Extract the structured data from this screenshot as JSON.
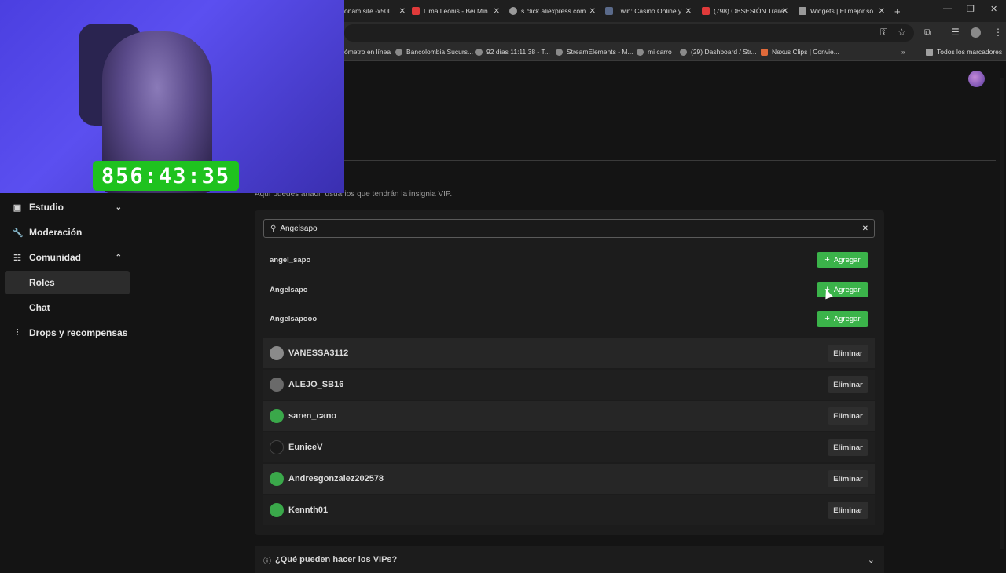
{
  "browser": {
    "tabs": [
      {
        "title": "onam.site -x50l",
        "color": "#6a6a6a"
      },
      {
        "title": "Lima Leonis - Bei Min",
        "color": "#e03a3a"
      },
      {
        "title": "s.click.aliexpress.com",
        "color": "#9a9a9a"
      },
      {
        "title": "Twin: Casino Online y",
        "color": "#5a6a8a"
      },
      {
        "title": "(798) OBSESIÓN Tráile",
        "color": "#e03a3a"
      },
      {
        "title": "Widgets | El mejor so",
        "color": "#9a9a9a"
      }
    ],
    "new_tab": "+",
    "bookmarks": [
      "ómetro en línea",
      "Bancolombia Sucurs...",
      "92 días 11:11:38 - T...",
      "StreamElements - M...",
      "mi carro",
      "(29) Dashboard / Str...",
      "Nexus Clips | Convie..."
    ],
    "all_bookmarks": "Todos los marcadores"
  },
  "overlay": {
    "timer": "856:43:35"
  },
  "sidebar": {
    "items": [
      {
        "label": "Estudio",
        "icon": "studio-icon",
        "chevron": "down"
      },
      {
        "label": "Moderación",
        "icon": "wrench-icon"
      },
      {
        "label": "Comunidad",
        "icon": "community-icon",
        "chevron": "up"
      },
      {
        "label": "Roles",
        "active": true
      },
      {
        "label": "Chat"
      },
      {
        "label": "Drops y recompensas",
        "icon": "drops-icon"
      }
    ]
  },
  "main": {
    "subtitle": "Aquí puedes añadir usuarios que tendrán la insignia VIP.",
    "search": {
      "value": "Angelsapo"
    },
    "results": [
      {
        "name": "angel_sapo",
        "action": "Agregar"
      },
      {
        "name": "Angelsapo",
        "action": "Agregar"
      },
      {
        "name": "Angelsapooo",
        "action": "Agregar"
      }
    ],
    "vips": [
      {
        "name": "VANESSA3112",
        "action": "Eliminar",
        "avatar_color": "#8a8a8a"
      },
      {
        "name": "ALEJO_SB16",
        "action": "Eliminar",
        "avatar_color": "#6a6a6a"
      },
      {
        "name": "saren_cano",
        "action": "Eliminar",
        "avatar_color": "#3aa84a"
      },
      {
        "name": "EuniceV",
        "action": "Eliminar",
        "avatar_color": "#1a1a1a"
      },
      {
        "name": "Andresgonzalez202578",
        "action": "Eliminar",
        "avatar_color": "#3aa84a"
      },
      {
        "name": "Kennth01",
        "action": "Eliminar",
        "avatar_color": "#3aa84a"
      }
    ],
    "faq": "¿Qué pueden hacer los VIPs?"
  },
  "colors": {
    "accent_green": "#3bb34a",
    "timer_green": "#1fc21f"
  }
}
